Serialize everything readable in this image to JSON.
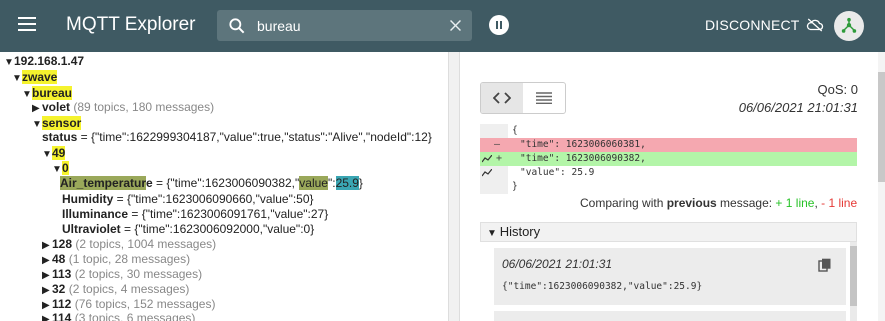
{
  "app": {
    "title": "MQTT Explorer"
  },
  "search": {
    "value": "bureau",
    "placeholder": ""
  },
  "toolbar": {
    "disconnect_label": "DISCONNECT"
  },
  "tree": {
    "root": "192.168.1.47",
    "zwave": "zwave",
    "bureau": "bureau",
    "volet": {
      "name": "volet",
      "meta": "(89 topics, 180 messages)"
    },
    "sensor": "sensor",
    "status": {
      "name": "status",
      "value": " = {\"time\":1622999304187,\"value\":true,\"status\":\"Alive\",\"nodeId\":12}"
    },
    "n49": "49",
    "n0": "0",
    "air_temp": {
      "name_hl": "Air_temperatur",
      "name_rest": "e",
      "value_a": " = {\"time\":1623006090382,\"",
      "value_key": "value",
      "value_b": "\":",
      "value_num": "25.9",
      "value_c": "}"
    },
    "humidity": {
      "name": "Humidity",
      "value": " = {\"time\":1623006090660,\"value\":50}"
    },
    "illuminance": {
      "name": "Illuminance",
      "value": " = {\"time\":1623006091761,\"value\":27}"
    },
    "ultraviolet": {
      "name": "Ultraviolet",
      "value": " = {\"time\":1623006092000,\"value\":0}"
    },
    "n128": {
      "name": "128",
      "meta": "(2 topics, 1004 messages)"
    },
    "n48": {
      "name": "48",
      "meta": "(1 topic, 28 messages)"
    },
    "n113": {
      "name": "113",
      "meta": "(2 topics, 30 messages)"
    },
    "n32": {
      "name": "32",
      "meta": "(2 topics, 4 messages)"
    },
    "n112": {
      "name": "112",
      "meta": "(76 topics, 152 messages)"
    },
    "n114": {
      "name": "114",
      "meta": "(3 topics, 6 messages)"
    }
  },
  "details": {
    "qos": "QoS: 0",
    "timestamp": "06/06/2021 21:01:31",
    "diff": {
      "open": "{",
      "removed": "\"time\": 1623006060381,",
      "added": "\"time\": 1623006090382,",
      "value": "\"value\": 25.9",
      "close": "}",
      "gutter_minus": "–",
      "gutter_plus": "+"
    },
    "compare": {
      "prefix": "Comparing with ",
      "bold": "previous",
      "mid": " message: ",
      "plus": "+ 1 line",
      "sep": ", ",
      "minus": "- 1 line"
    },
    "history": {
      "label": "History",
      "entry_time": "06/06/2021 21:01:31",
      "entry_payload": "{\"time\":1623006090382,\"value\":25.9}"
    }
  }
}
